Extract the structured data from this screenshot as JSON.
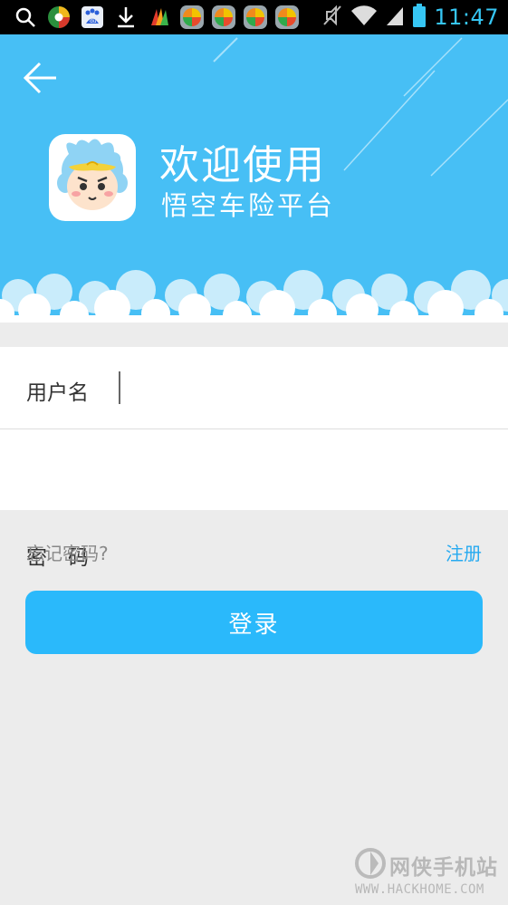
{
  "status_bar": {
    "time": "11:47",
    "left_icons": [
      "search-icon",
      "browser-icon",
      "baidu-icon",
      "download-icon",
      "book-icon",
      "game-app-icon",
      "game-app-icon",
      "game-app-icon",
      "game-app-icon"
    ],
    "right_icons": [
      "mute-icon",
      "wifi-icon",
      "signal-icon",
      "battery-icon"
    ],
    "baidu_text": "du"
  },
  "header": {
    "welcome_title": "欢迎使用",
    "subtitle": "悟空车险平台",
    "background_color": "#47bff5"
  },
  "form": {
    "username_label": "用户名",
    "password_label": "密　码",
    "username_value": "",
    "password_value": ""
  },
  "links": {
    "forgot_password": "忘记密码?",
    "register": "注册"
  },
  "login_button": {
    "label": "登录",
    "color": "#2ab9fb"
  },
  "watermark": {
    "name": "网侠手机站",
    "url": "WWW.HACKHOME.COM"
  }
}
